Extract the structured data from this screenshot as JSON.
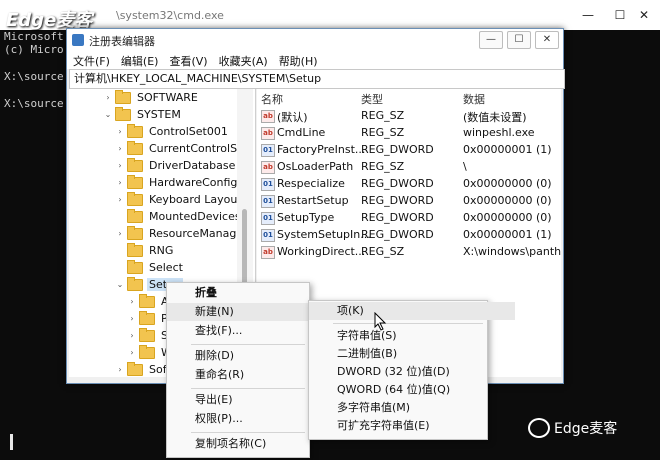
{
  "cmd": {
    "title": "\\system32\\cmd.exe",
    "lines": [
      "Microsoft",
      "(c) Micro",
      "X:\\source",
      "X:\\source"
    ]
  },
  "watermark": {
    "top": "Edge麦客",
    "bottom": "Edge麦客"
  },
  "regedit": {
    "title": "注册表编辑器",
    "menu": [
      "文件(F)",
      "编辑(E)",
      "查看(V)",
      "收藏夹(A)",
      "帮助(H)"
    ],
    "address": "计算机\\HKEY_LOCAL_MACHINE\\SYSTEM\\Setup",
    "tree": [
      {
        "label": "SOFTWARE",
        "arrow": "›"
      },
      {
        "label": "SYSTEM",
        "arrow": "⌄"
      },
      {
        "label": "ControlSet001",
        "arrow": "›"
      },
      {
        "label": "CurrentControlSet",
        "arrow": "›"
      },
      {
        "label": "DriverDatabase",
        "arrow": "›"
      },
      {
        "label": "HardwareConfig",
        "arrow": "›"
      },
      {
        "label": "Keyboard Layout",
        "arrow": "›"
      },
      {
        "label": "MountedDevices",
        "arrow": ""
      },
      {
        "label": "ResourceManager",
        "arrow": "›"
      },
      {
        "label": "RNG",
        "arrow": ""
      },
      {
        "label": "Select",
        "arrow": ""
      },
      {
        "label": "Setup",
        "arrow": "⌄"
      },
      {
        "label": "A",
        "arrow": "›"
      },
      {
        "label": "P",
        "arrow": "›"
      },
      {
        "label": "S",
        "arrow": "›"
      },
      {
        "label": "W",
        "arrow": "›"
      },
      {
        "label": "Soft",
        "arrow": "›"
      }
    ],
    "columns": {
      "name": "名称",
      "type": "类型",
      "data": "数据"
    },
    "values": [
      {
        "icon": "ab",
        "name": "(默认)",
        "type": "REG_SZ",
        "data": "(数值未设置)"
      },
      {
        "icon": "ab",
        "name": "CmdLine",
        "type": "REG_SZ",
        "data": "winpeshl.exe"
      },
      {
        "icon": "bin",
        "name": "FactoryPreInst...",
        "type": "REG_DWORD",
        "data": "0x00000001 (1)"
      },
      {
        "icon": "ab",
        "name": "OsLoaderPath",
        "type": "REG_SZ",
        "data": "\\"
      },
      {
        "icon": "bin",
        "name": "Respecialize",
        "type": "REG_DWORD",
        "data": "0x00000000 (0)"
      },
      {
        "icon": "bin",
        "name": "RestartSetup",
        "type": "REG_DWORD",
        "data": "0x00000000 (0)"
      },
      {
        "icon": "bin",
        "name": "SetupType",
        "type": "REG_DWORD",
        "data": "0x00000000 (0)"
      },
      {
        "icon": "bin",
        "name": "SystemSetupIn...",
        "type": "REG_DWORD",
        "data": "0x00000001 (1)"
      },
      {
        "icon": "ab",
        "name": "WorkingDirect...",
        "type": "REG_SZ",
        "data": "X:\\windows\\panther"
      }
    ]
  },
  "context_menu": {
    "collapse": "折叠",
    "new": "新建(N)",
    "find": "查找(F)...",
    "delete": "删除(D)",
    "rename": "重命名(R)",
    "export": "导出(E)",
    "permissions": "权限(P)...",
    "copy_key_name": "复制项名称(C)"
  },
  "submenu": {
    "key": "项(K)",
    "string": "字符串值(S)",
    "binary": "二进制值(B)",
    "dword": "DWORD (32 位)值(D)",
    "qword": "QWORD (64 位)值(Q)",
    "multi_string": "多字符串值(M)",
    "expandable_string": "可扩充字符串值(E)"
  }
}
